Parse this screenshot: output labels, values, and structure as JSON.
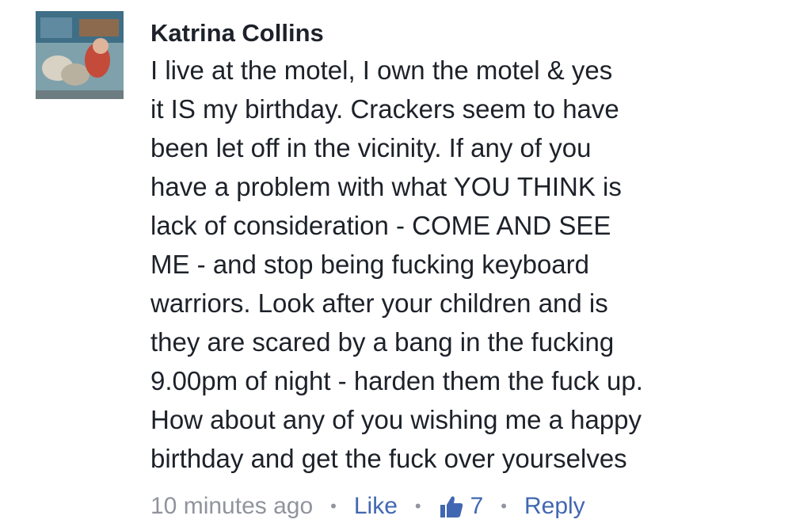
{
  "comment": {
    "author": "Katrina Collins",
    "avatar_icon": "profile-photo",
    "lines": [
      "I live at the motel, I own the motel & yes",
      "it IS my birthday. Crackers seem to have",
      "been let off in the vicinity. If any of you",
      "have a problem with what YOU THINK is",
      "lack of consideration - COME AND SEE",
      "ME - and stop being fucking keyboard",
      "warriors. Look after your children and is",
      "they are scared by a bang in the fucking",
      "9.00pm of night - harden them the fuck up.",
      "How about any of you wishing me a happy",
      "birthday and get the fuck over yourselves"
    ],
    "timestamp": "10 minutes ago",
    "separator": "•",
    "like_label": "Like",
    "like_icon": "thumbs-up-icon",
    "like_count": "7",
    "reply_label": "Reply"
  },
  "colors": {
    "text": "#1d2129",
    "meta_gray": "#90949c",
    "link_blue": "#4267b2"
  }
}
